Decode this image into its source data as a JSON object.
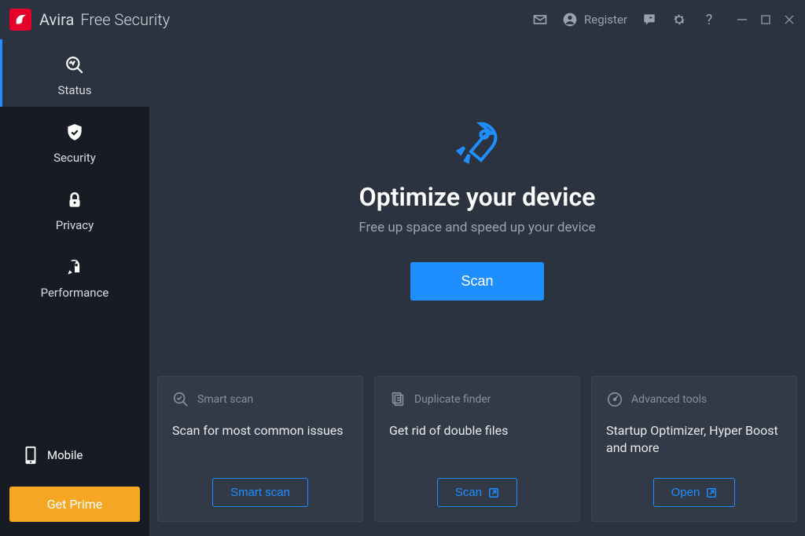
{
  "header": {
    "brand": "Avira",
    "suffix": "Free Security",
    "register": "Register"
  },
  "sidebar": {
    "items": [
      {
        "label": "Status"
      },
      {
        "label": "Security"
      },
      {
        "label": "Privacy"
      },
      {
        "label": "Performance"
      }
    ],
    "mobile": "Mobile",
    "prime": "Get Prime"
  },
  "hero": {
    "title": "Optimize your device",
    "subtitle": "Free up space and speed up your device",
    "scan": "Scan"
  },
  "cards": [
    {
      "title": "Smart scan",
      "desc": "Scan for most common issues",
      "button": "Smart scan"
    },
    {
      "title": "Duplicate finder",
      "desc": "Get rid of double files",
      "button": "Scan"
    },
    {
      "title": "Advanced tools",
      "desc": "Startup Optimizer, Hyper Boost and more",
      "button": "Open"
    }
  ]
}
